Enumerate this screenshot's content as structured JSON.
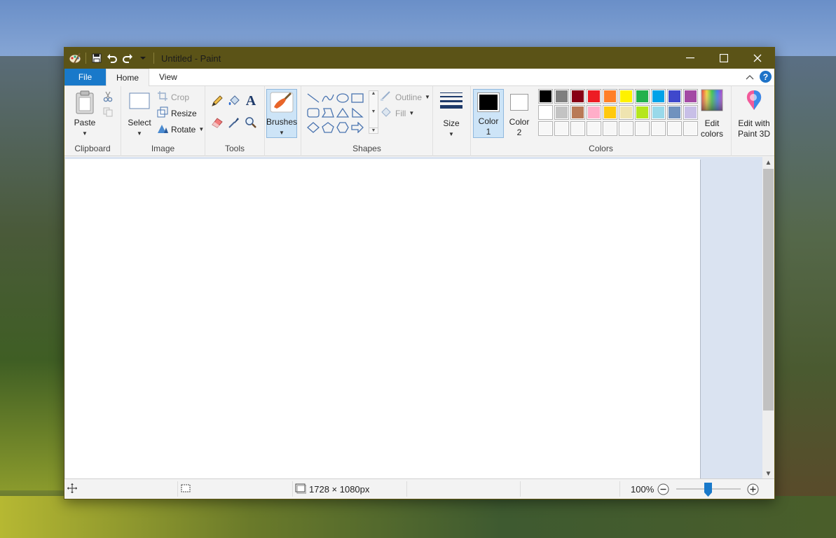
{
  "window": {
    "title": "Untitled - Paint"
  },
  "tabs": {
    "file": "File",
    "home": "Home",
    "view": "View"
  },
  "clipboard": {
    "paste": "Paste",
    "label": "Clipboard"
  },
  "image": {
    "select": "Select",
    "crop": "Crop",
    "resize": "Resize",
    "rotate": "Rotate",
    "label": "Image"
  },
  "tools": {
    "label": "Tools"
  },
  "brushes": {
    "label": "Brushes"
  },
  "shapes": {
    "outline": "Outline",
    "fill": "Fill",
    "label": "Shapes"
  },
  "size": {
    "label": "Size"
  },
  "colors": {
    "color1_label": "Color",
    "color1_num": "1",
    "color2_label": "Color",
    "color2_num": "2",
    "color1_value": "#000000",
    "color2_value": "#ffffff",
    "edit_colors_line1": "Edit",
    "edit_colors_line2": "colors",
    "edit_3d_line1": "Edit with",
    "edit_3d_line2": "Paint 3D",
    "label": "Colors",
    "palette": [
      "#000000",
      "#7f7f7f",
      "#880015",
      "#ed1c24",
      "#ff7f27",
      "#fff200",
      "#22b14c",
      "#00a2e8",
      "#3f48cc",
      "#a349a4",
      "#ffffff",
      "#c3c3c3",
      "#b97a57",
      "#ffaec9",
      "#ffc90e",
      "#efe4b0",
      "#b5e61d",
      "#99d9ea",
      "#7092be",
      "#c8bfe7",
      "",
      "",
      "",
      "",
      "",
      "",
      "",
      "",
      "",
      ""
    ]
  },
  "status": {
    "dimensions": "1728 × 1080px",
    "zoom": "100%",
    "zoom_level_percent": 100
  }
}
